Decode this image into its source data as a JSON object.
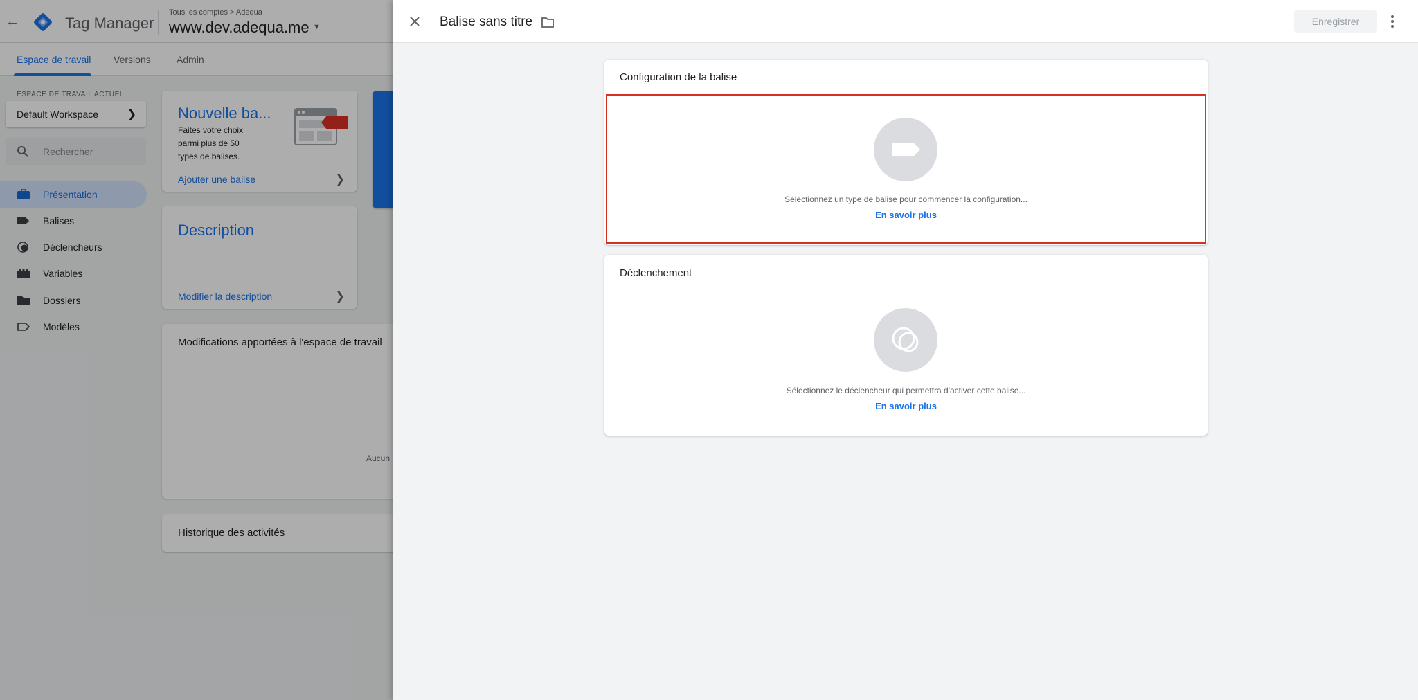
{
  "app": {
    "product_name": "Tag Manager",
    "breadcrumb": "Tous les comptes > Adequa",
    "container_name": "www.dev.adequa.me"
  },
  "nav_tabs": [
    {
      "label": "Espace de travail",
      "active": true
    },
    {
      "label": "Versions",
      "active": false
    },
    {
      "label": "Admin",
      "active": false
    }
  ],
  "workspace": {
    "section_label": "ESPACE DE TRAVAIL ACTUEL",
    "current": "Default Workspace"
  },
  "search": {
    "placeholder": "Rechercher"
  },
  "sidebar": {
    "items": [
      {
        "label": "Présentation",
        "icon": "briefcase-icon",
        "active": true
      },
      {
        "label": "Balises",
        "icon": "tag-icon"
      },
      {
        "label": "Déclencheurs",
        "icon": "trigger-icon"
      },
      {
        "label": "Variables",
        "icon": "variables-icon"
      },
      {
        "label": "Dossiers",
        "icon": "folder-icon"
      },
      {
        "label": "Modèles",
        "icon": "template-icon"
      }
    ]
  },
  "overview": {
    "new_tag": {
      "title": "Nouvelle ba...",
      "description": "Faites votre choix parmi plus de 50 types de balises.",
      "link": "Ajouter une balise"
    },
    "description_card": {
      "title": "Description",
      "link": "Modifier la description"
    },
    "changes_card": {
      "title": "Modifications apportées à l'espace de travail",
      "empty": "Aucun"
    },
    "history_card": {
      "title": "Historique des activités"
    }
  },
  "sheet": {
    "tag_name": "Balise sans titre",
    "save_label": "Enregistrer",
    "config": {
      "title": "Configuration de la balise",
      "prompt": "Sélectionnez un type de balise pour commencer la configuration...",
      "learn_more": "En savoir plus"
    },
    "trigger": {
      "title": "Déclenchement",
      "prompt": "Sélectionnez le déclencheur qui permettra d'activer cette balise...",
      "learn_more": "En savoir plus"
    }
  },
  "colors": {
    "accent": "#1a73e8",
    "highlight_border": "#d93025",
    "gtm_logo": "#1a73e8"
  }
}
